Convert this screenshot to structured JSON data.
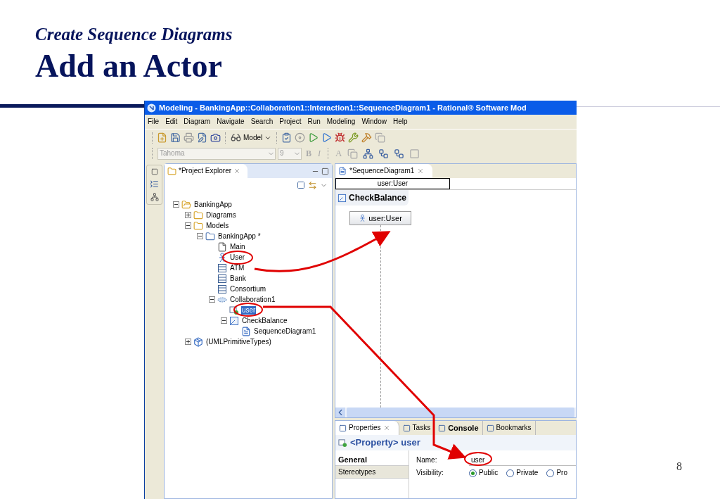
{
  "slide": {
    "subtitle": "Create Sequence Diagrams",
    "title": "Add an Actor",
    "page_number": "8"
  },
  "window": {
    "title": "Modeling - BankingApp::Collaboration1::Interaction1::SequenceDiagram1 - Rational® Software Mod"
  },
  "menu": [
    "File",
    "Edit",
    "Diagram",
    "Navigate",
    "Search",
    "Project",
    "Run",
    "Modeling",
    "Window",
    "Help"
  ],
  "toolbar": {
    "model_button": "Model",
    "font_field": "Tahoma",
    "size_field": "9",
    "bold_button": "B",
    "italic_button": "I",
    "font_color_button": "A"
  },
  "explorer": {
    "tab": "*Project Explorer",
    "tree": [
      {
        "label": "BankingApp",
        "kind": "project",
        "expanded": true,
        "selected": false,
        "children": [
          {
            "label": "Diagrams",
            "kind": "folder",
            "expanded": false,
            "selected": false
          },
          {
            "label": "Models",
            "kind": "folder",
            "expanded": true,
            "selected": false,
            "children": [
              {
                "label": "BankingApp *",
                "kind": "package",
                "expanded": true,
                "selected": false,
                "children": [
                  {
                    "label": "Main",
                    "kind": "page",
                    "selected": false
                  },
                  {
                    "label": "User",
                    "kind": "actor",
                    "selected": false
                  },
                  {
                    "label": "ATM",
                    "kind": "class",
                    "selected": false
                  },
                  {
                    "label": "Bank",
                    "kind": "class",
                    "selected": false
                  },
                  {
                    "label": "Consortium",
                    "kind": "class",
                    "selected": false
                  },
                  {
                    "label": "Collaboration1",
                    "kind": "collaboration",
                    "expanded": true,
                    "selected": false,
                    "children": [
                      {
                        "label": "user",
                        "kind": "part",
                        "selected": true
                      },
                      {
                        "label": "CheckBalance",
                        "kind": "interaction",
                        "expanded": true,
                        "selected": false,
                        "children": [
                          {
                            "label": "SequenceDiagram1",
                            "kind": "diagram",
                            "selected": false
                          }
                        ]
                      }
                    ]
                  }
                ]
              }
            ]
          },
          {
            "label": "(UMLPrimitiveTypes)",
            "kind": "library",
            "expanded": false,
            "selected": false
          }
        ]
      }
    ]
  },
  "editor": {
    "tab": "*SequenceDiagram1",
    "name_field": "user:User",
    "frame_label": "CheckBalance",
    "lifeline": "user:User"
  },
  "properties": {
    "tabs": [
      {
        "label": "Properties",
        "selected": true,
        "bold": false
      },
      {
        "label": "Tasks",
        "selected": false,
        "bold": false
      },
      {
        "label": "Console",
        "selected": false,
        "bold": true
      },
      {
        "label": "Bookmarks",
        "selected": false,
        "bold": false
      }
    ],
    "header": "<Property> user",
    "sections": [
      {
        "label": "General",
        "selected": true
      },
      {
        "label": "Stereotypes",
        "selected": false
      }
    ],
    "name_label": "Name:",
    "name_value": "user",
    "visibility_label": "Visibility:",
    "visibility": [
      {
        "label": "Public",
        "selected": true
      },
      {
        "label": "Private",
        "selected": false
      },
      {
        "label": "Pro",
        "selected": false
      }
    ]
  }
}
